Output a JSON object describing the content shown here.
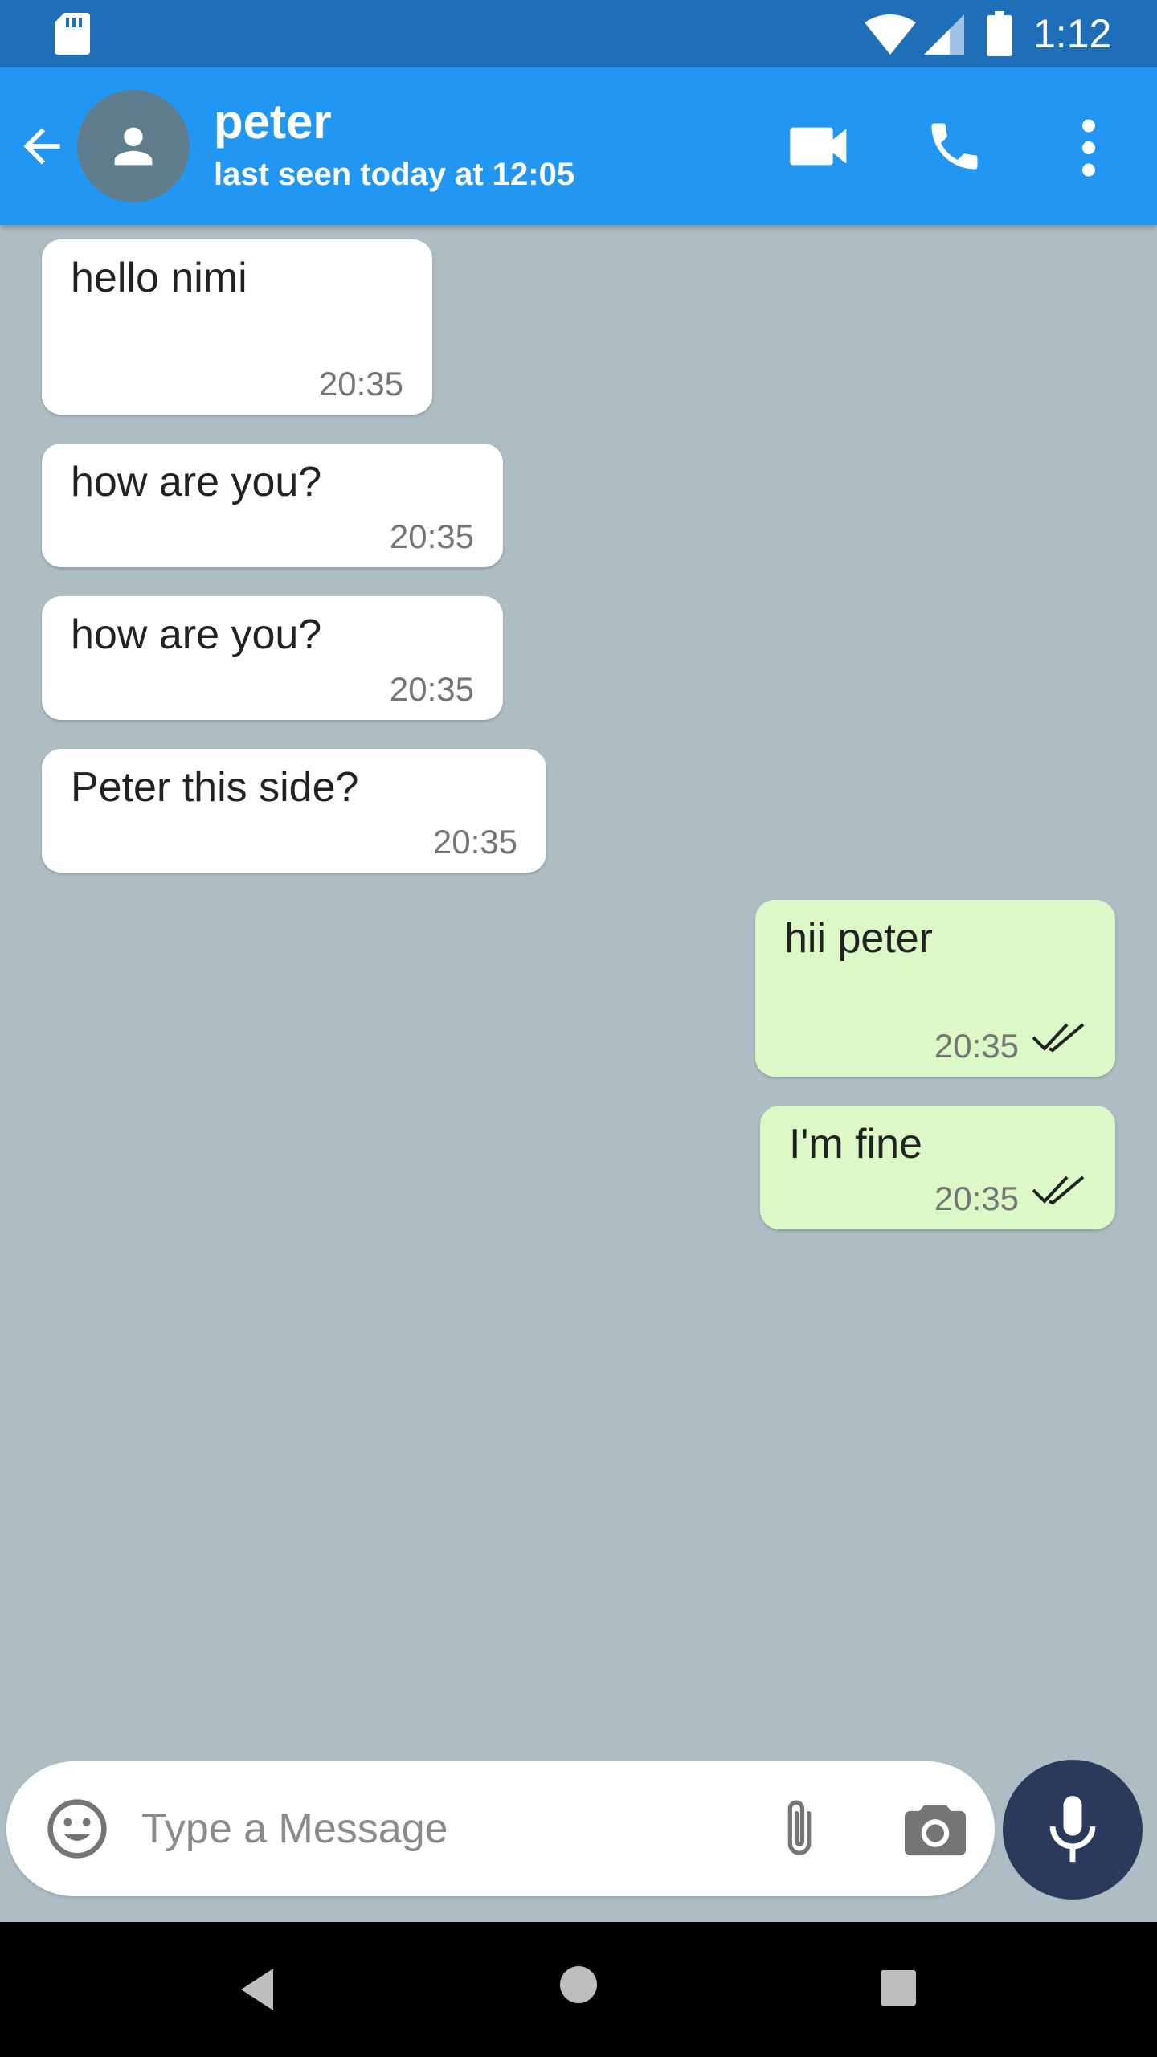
{
  "status_bar": {
    "time": "1:12",
    "icons": [
      "sd-card-icon",
      "wifi-icon",
      "signal-icon",
      "battery-icon"
    ]
  },
  "chat_header": {
    "name": "peter",
    "status": "last seen today at 12:05",
    "icons": [
      "back-arrow-icon",
      "person-icon",
      "video-camera-icon",
      "phone-icon",
      "more-vert-icon"
    ]
  },
  "messages": [
    {
      "direction": "incoming",
      "text": "hello nimi",
      "time": "20:35"
    },
    {
      "direction": "incoming",
      "text": "how are you?",
      "time": "20:35"
    },
    {
      "direction": "incoming",
      "text": "how are you?",
      "time": "20:35"
    },
    {
      "direction": "incoming",
      "text": "Peter this side?",
      "time": "20:35"
    },
    {
      "direction": "outgoing",
      "text": "hii peter",
      "time": "20:35",
      "status_icon": "double-check-icon"
    },
    {
      "direction": "outgoing",
      "text": "I'm fine",
      "time": "20:35",
      "status_icon": "double-check-icon"
    }
  ],
  "composer": {
    "placeholder": "Type a Message",
    "value": "",
    "icons": [
      "emoji-icon",
      "attach-icon",
      "camera-icon",
      "mic-icon"
    ]
  },
  "nav_bar": {
    "icons": [
      "nav-back-icon",
      "nav-home-icon",
      "nav-recents-icon"
    ]
  },
  "colors": {
    "status_bar": "#1e6fb8",
    "app_bar": "#2196f3",
    "chat_background": "#aebcc3",
    "incoming_bubble": "#ffffff",
    "outgoing_bubble": "#dcf8c6",
    "mic_button": "#2b3a5b"
  }
}
